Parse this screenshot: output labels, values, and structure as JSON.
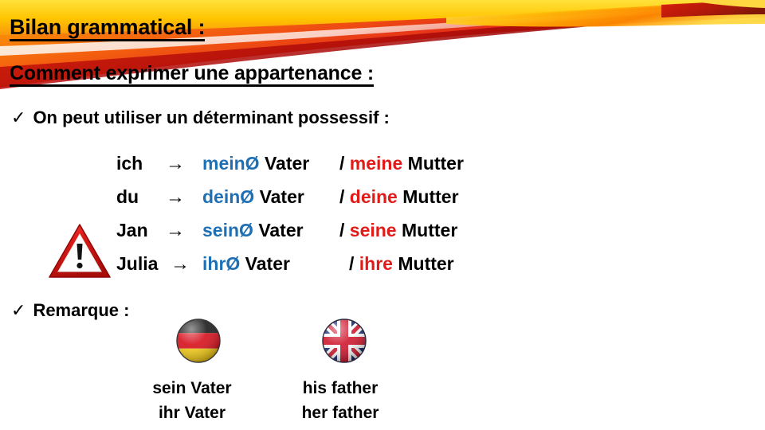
{
  "header": {
    "title": "Bilan grammatical :",
    "subtitle": "Comment exprimer une appartenance :"
  },
  "bullets": {
    "check_glyph": "✓",
    "possessive": "On peut utiliser un déterminant possessif :",
    "remark": "Remarque :"
  },
  "possessive_table": {
    "arrow_glyph": "→",
    "separator": "/",
    "rows": [
      {
        "pronoun": "ich",
        "masc_possessive": "meinØ",
        "masc_noun": "Vater",
        "fem_possessive": "meine",
        "fem_noun": "Mutter"
      },
      {
        "pronoun": "du",
        "masc_possessive": "deinØ",
        "masc_noun": "Vater",
        "fem_possessive": "deine",
        "fem_noun": "Mutter"
      },
      {
        "pronoun": "Jan",
        "masc_possessive": "seinØ",
        "masc_noun": "Vater",
        "fem_possessive": "seine",
        "fem_noun": "Mutter"
      },
      {
        "pronoun": "Julia",
        "masc_possessive": "ihrØ",
        "masc_noun": "Vater",
        "fem_possessive": "ihre",
        "fem_noun": "Mutter"
      }
    ]
  },
  "translations": {
    "german": {
      "line1": "sein Vater",
      "line2": "ihr Vater"
    },
    "english": {
      "line1": "his father",
      "line2": "her father"
    }
  },
  "icons": {
    "warning": "warning-triangle-icon",
    "flag_de": "german-flag-icon",
    "flag_gb": "uk-flag-icon"
  },
  "colors": {
    "masculine_blue": "#1f6fb5",
    "feminine_red": "#e01b18",
    "text_black": "#000000",
    "swoosh_yellow": "#ffd400",
    "swoosh_orange": "#f57a10",
    "swoosh_red": "#e2251b",
    "swoosh_dark_red": "#9e0b0b"
  }
}
